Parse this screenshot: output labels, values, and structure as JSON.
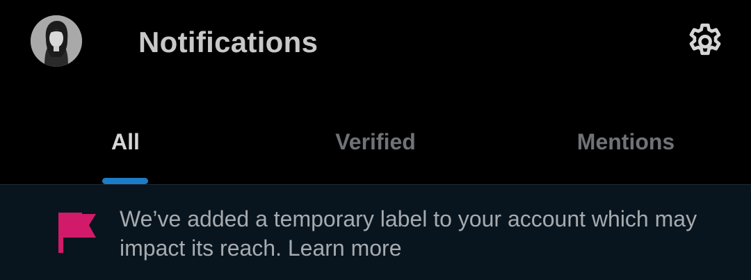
{
  "header": {
    "title": "Notifications",
    "avatar_icon": "user-avatar",
    "settings_icon": "gear-icon"
  },
  "tabs": [
    {
      "label": "All",
      "active": true
    },
    {
      "label": "Verified",
      "active": false
    },
    {
      "label": "Mentions",
      "active": false
    }
  ],
  "banner": {
    "icon": "flag-icon",
    "message": "We’ve added a temporary label to your account which may impact its reach.",
    "link_label": "Learn more"
  },
  "colors": {
    "background": "#000000",
    "banner_background": "#09151e",
    "accent_indicator": "#1d7cc6",
    "flag": "#d11a6a",
    "title_text": "#c8c8c8",
    "inactive_tab_text": "#6f7377"
  }
}
